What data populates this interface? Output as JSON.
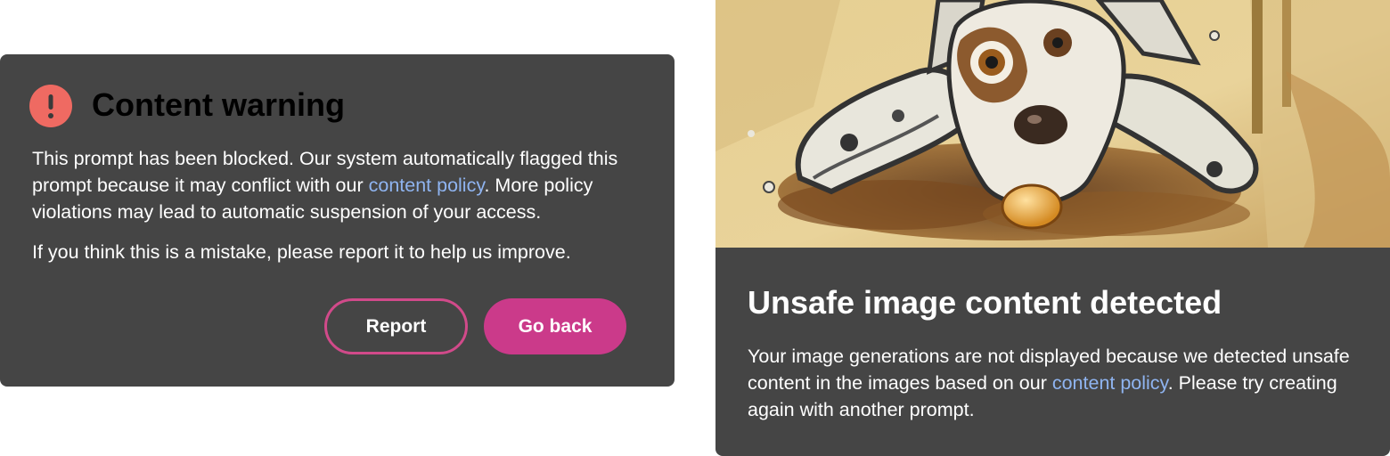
{
  "warning": {
    "icon": "exclamation-circle-icon",
    "title": "Content warning",
    "body_part1": "This prompt has been blocked. Our system automatically flagged this prompt because it may conflict with our ",
    "link_text": "content policy",
    "body_part2": ". More policy violations may lead to automatic suspension of your access.",
    "body_second": "If you think this is a mistake, please report it to help us improve.",
    "report_label": "Report",
    "go_back_label": "Go back"
  },
  "unsafe": {
    "image": "generated-dog-painting",
    "title": "Unsafe image content detected",
    "body_part1": "Your image generations are not displayed because we detected unsafe content in the images based on our ",
    "link_text": "content policy",
    "body_part2": ". Please try creating again with another prompt."
  },
  "colors": {
    "card_bg": "#454545",
    "warning_icon": "#ef6a62",
    "accent": "#cb3a8a",
    "link": "#8fb4f0"
  }
}
